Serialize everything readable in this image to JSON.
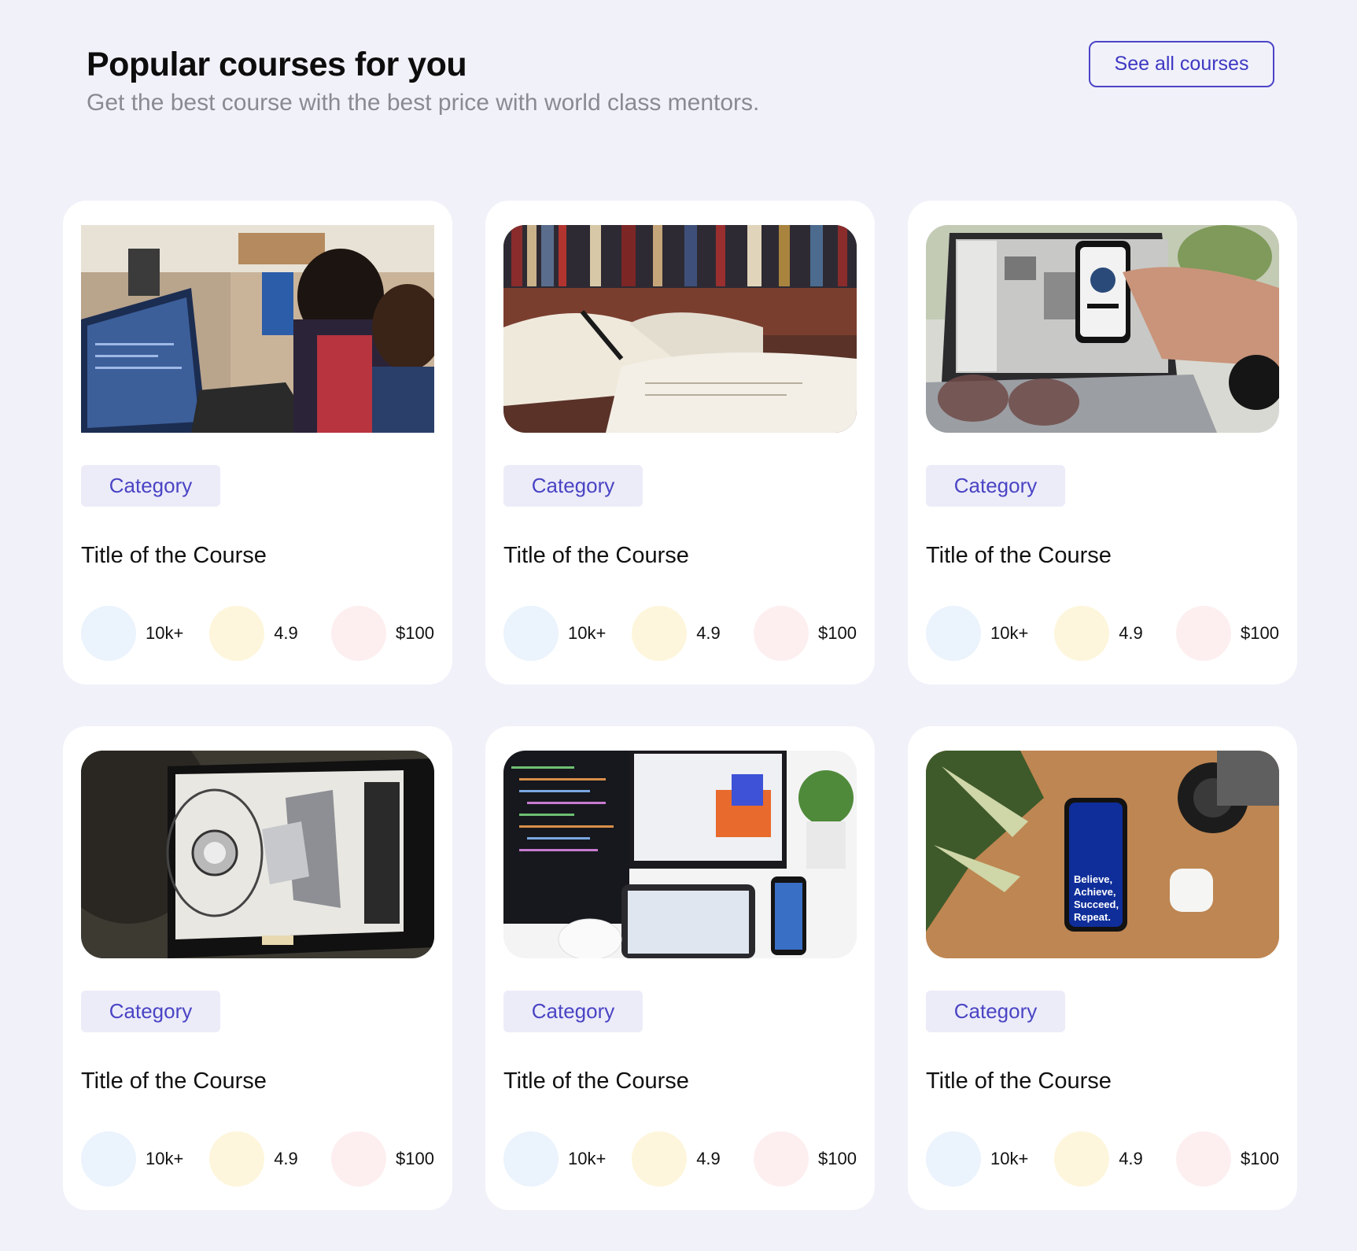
{
  "header": {
    "title": "Popular courses for you",
    "subtitle": "Get the best course with the best price with world class mentors.",
    "see_all_label": "See all courses"
  },
  "colors": {
    "accent": "#4a44c4",
    "background": "#f1f1fa",
    "tag_background": "#ececf9",
    "dot_students": "#ebf3fc",
    "dot_rating": "#fdf6dc",
    "dot_price": "#fdeff0"
  },
  "courses": [
    {
      "category": "Category",
      "title": "Title of the Course",
      "students": "10k+",
      "rating": "4.9",
      "price": "$100",
      "image": "team-coding-photo"
    },
    {
      "category": "Category",
      "title": "Title of the Course",
      "students": "10k+",
      "rating": "4.9",
      "price": "$100",
      "image": "open-books-photo"
    },
    {
      "category": "Category",
      "title": "Title of the Course",
      "students": "10k+",
      "rating": "4.9",
      "price": "$100",
      "image": "laptop-phone-photo"
    },
    {
      "category": "Category",
      "title": "Title of the Course",
      "students": "10k+",
      "rating": "4.9",
      "price": "$100",
      "image": "cad-monitor-photo"
    },
    {
      "category": "Category",
      "title": "Title of the Course",
      "students": "10k+",
      "rating": "4.9",
      "price": "$100",
      "image": "code-devices-photo"
    },
    {
      "category": "Category",
      "title": "Title of the Course",
      "students": "10k+",
      "rating": "4.9",
      "price": "$100",
      "image": "phone-desk-photo",
      "image_text": "Believe, Achieve, Succeed, Repeat."
    }
  ]
}
